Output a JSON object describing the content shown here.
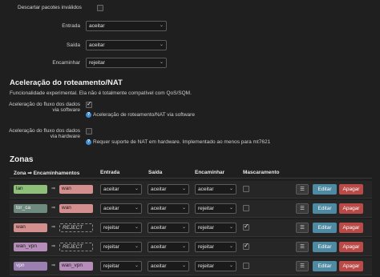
{
  "general": {
    "drop_invalid_label": "Descartar pacotes inválidos",
    "input_label": "Entrada",
    "input_value": "aceitar",
    "output_label": "Saída",
    "output_value": "aceitar",
    "forward_label": "Encaminhar",
    "forward_value": "rejeitar"
  },
  "offload": {
    "title": "Aceleração do roteamento/NAT",
    "description": "Funcionalidade experimental. Ela não é totalmente compatível com QoS/SQM.",
    "sw_label_1": "Aceleração do fluxo dos dados",
    "sw_label_2": "via software",
    "sw_hint": "Aceleração de roteamento/NAT via software",
    "hw_label_1": "Aceleração do fluxo dos dados",
    "hw_label_2": "via hardware",
    "hw_hint": "Requer suporte de NAT em hardware. Implementado ao menos para mt7621"
  },
  "zones": {
    "title": "Zonas",
    "headers": {
      "zone": "Zona ⇒ Encaminhamentos",
      "input": "Entrada",
      "output": "Saída",
      "forward": "Encaminhar",
      "masq": "Mascaramento"
    },
    "rows": [
      {
        "zone": "lan",
        "target": "wan",
        "input": "aceitar",
        "output": "aceitar",
        "forward": "aceitar"
      },
      {
        "zone": "tor_ca",
        "target": "wan",
        "input": "aceitar",
        "output": "aceitar",
        "forward": "rejeitar"
      },
      {
        "zone": "wan",
        "target": "REJECT",
        "input": "rejeitar",
        "output": "aceitar",
        "forward": "rejeitar"
      },
      {
        "zone": "wan_vpn",
        "target": "REJECT",
        "input": "rejeitar",
        "output": "aceitar",
        "forward": "rejeitar"
      },
      {
        "zone": "vpn",
        "target": "wan_vpn",
        "input": "rejeitar",
        "output": "aceitar",
        "forward": "rejeitar"
      }
    ],
    "edit_label": "Editar",
    "delete_label": "Apagar",
    "menu_glyph": "☰"
  },
  "colors": {
    "lan": "#8fc07a",
    "wan": "#d38e8e",
    "tor_ca": "#6f8a7f",
    "wan_vpn": "#b58db8",
    "vpn": "#9a7fb0"
  }
}
